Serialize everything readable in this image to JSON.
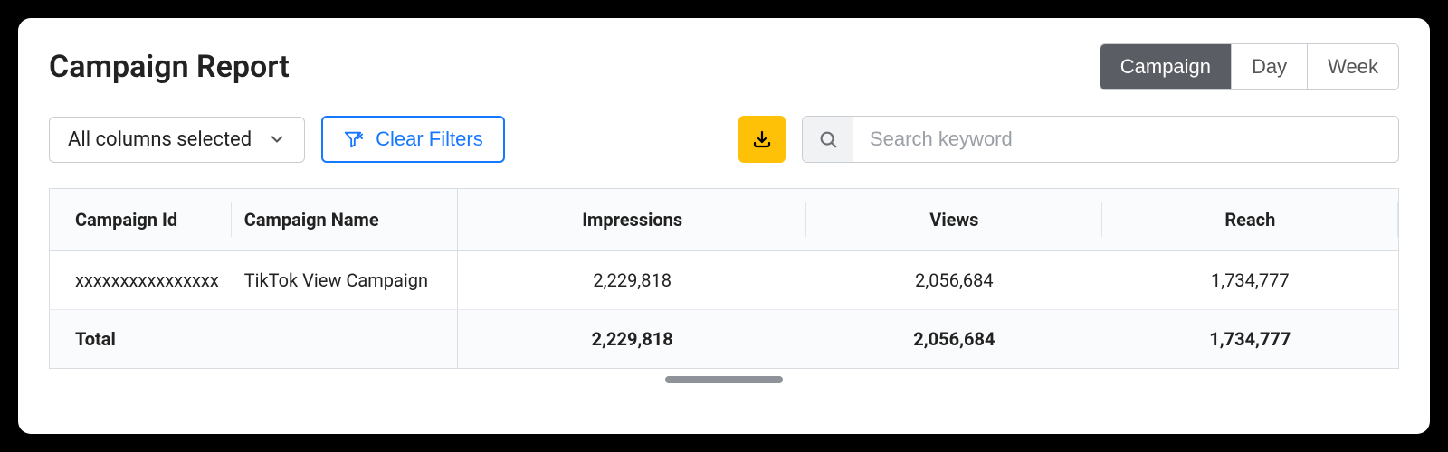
{
  "title": "Campaign Report",
  "view_toggle": {
    "options": [
      "Campaign",
      "Day",
      "Week"
    ],
    "active_index": 0
  },
  "toolbar": {
    "columns_dropdown_label": "All columns selected",
    "clear_filters_label": "Clear Filters",
    "search_placeholder": "Search keyword"
  },
  "icons": {
    "chevron_down": "chevron-down-icon",
    "filter": "filter-icon",
    "download": "download-icon",
    "search": "search-icon"
  },
  "table": {
    "columns": [
      "Campaign Id",
      "Campaign Name",
      "Impressions",
      "Views",
      "Reach"
    ],
    "rows": [
      {
        "campaign_id": "xxxxxxxxxxxxxxxx",
        "campaign_name": "TikTok View Campaign",
        "impressions": "2,229,818",
        "views": "2,056,684",
        "reach": "1,734,777"
      }
    ],
    "footer": {
      "label": "Total",
      "impressions": "2,229,818",
      "views": "2,056,684",
      "reach": "1,734,777"
    }
  }
}
